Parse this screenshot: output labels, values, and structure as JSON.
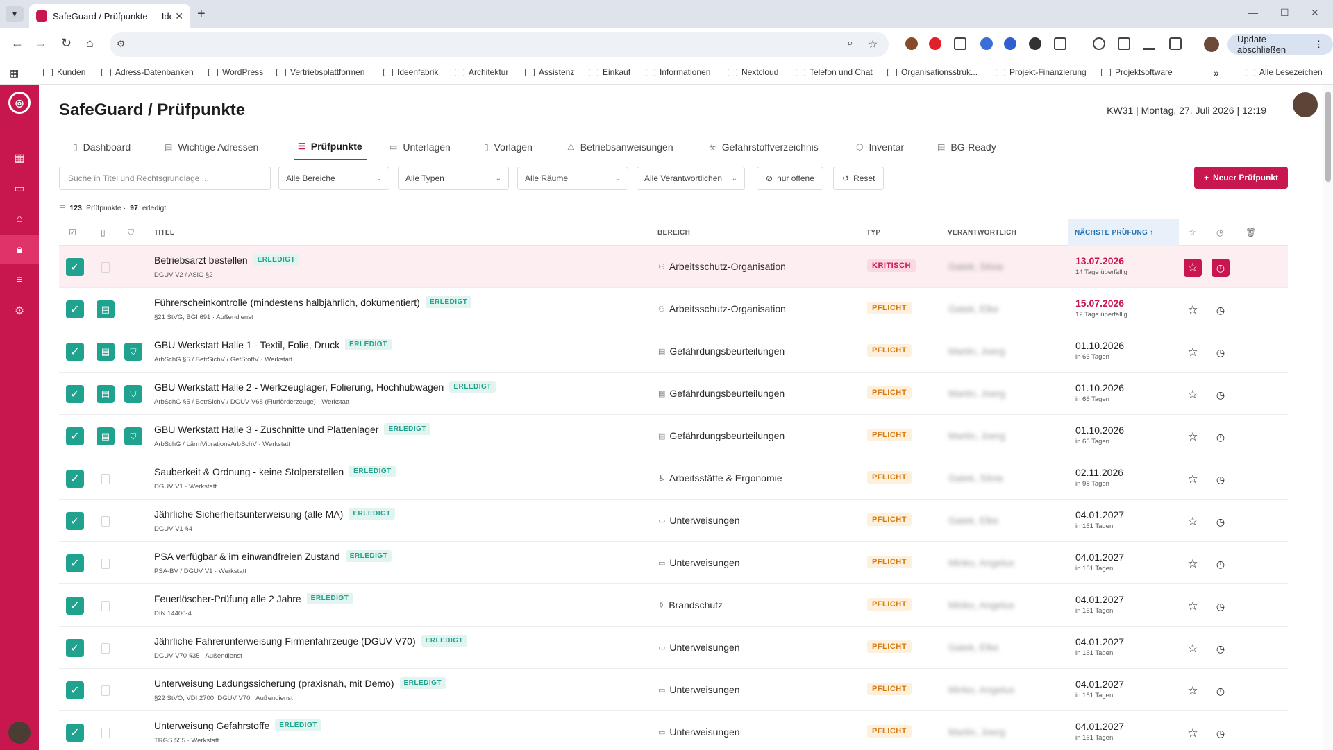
{
  "browser": {
    "tab_title": "SafeGuard / Prüfpunkte — Idee",
    "update_label": "Update abschließen",
    "bookmarks": [
      "Kunden",
      "Adress-Datenbanken",
      "WordPress",
      "Vertriebsplattformen",
      "Ideenfabrik",
      "Architektur",
      "Assistenz",
      "Einkauf",
      "Informationen",
      "Nextcloud",
      "Telefon und Chat",
      "Organisationsstruk...",
      "Projekt-Finanzierung",
      "Projektsoftware"
    ],
    "all_bookmarks": "Alle Lesezeichen"
  },
  "page": {
    "title": "SafeGuard / Prüfpunkte",
    "date_line": "KW31 | Montag, 27. Juli 2026 | 12:19"
  },
  "nav_tabs": [
    {
      "label": "Dashboard",
      "icon": "doc-icon"
    },
    {
      "label": "Wichtige Adressen",
      "icon": "address-icon"
    },
    {
      "label": "Prüfpunkte",
      "icon": "list-icon",
      "active": true
    },
    {
      "label": "Unterlagen",
      "icon": "folder-icon"
    },
    {
      "label": "Vorlagen",
      "icon": "template-icon"
    },
    {
      "label": "Betriebsanweisungen",
      "icon": "warning-icon"
    },
    {
      "label": "Gefahrstoffverzeichnis",
      "icon": "hazard-icon"
    },
    {
      "label": "Inventar",
      "icon": "box-icon"
    },
    {
      "label": "BG-Ready",
      "icon": "clipboard-icon"
    }
  ],
  "filters": {
    "search_placeholder": "Suche in Titel und Rechtsgrundlage ...",
    "areas": "Alle Bereiche",
    "types": "Alle Typen",
    "rooms": "Alle Räume",
    "responsible": "Alle Verantwortlichen",
    "only_open": "nur offene",
    "reset": "Reset",
    "new_button": "Neuer Prüfpunkt"
  },
  "summary": {
    "count": "123",
    "count_label": "Prüfpunkte ·",
    "done": "97",
    "done_label": "erledigt"
  },
  "columns": {
    "title": "TITEL",
    "area": "BEREICH",
    "type": "TYP",
    "responsible": "VERANTWORTLICH",
    "next": "NÄCHSTE PRÜFUNG ↑"
  },
  "colors": {
    "accent": "#c8174f",
    "done": "#1fa28e",
    "pflicht": "#d87a10"
  },
  "rows": [
    {
      "title": "Betriebsarzt bestellen",
      "badge": "ERLEDIGT",
      "sub": "DGUV V2 / ASiG §2",
      "area": "Arbeitsschutz-Organisation",
      "area_icon": "org-icon",
      "type": "KRITISCH",
      "responsible": "Gatek, Silvia",
      "date": "13.07.2026",
      "date_sub": "14 Tage überfällig",
      "overdue": true,
      "critical": true,
      "doc": false,
      "shield": false
    },
    {
      "title": "Führerscheinkontrolle (mindestens halbjährlich, dokumentiert)",
      "badge": "ERLEDIGT",
      "sub": "§21 StVG, BGI 691 · Außendienst",
      "area": "Arbeitsschutz-Organisation",
      "area_icon": "org-icon",
      "type": "PFLICHT",
      "responsible": "Gatek, Elke",
      "date": "15.07.2026",
      "date_sub": "12 Tage überfällig",
      "overdue": true,
      "critical": false,
      "doc": true,
      "shield": false
    },
    {
      "title": "GBU Werkstatt Halle 1 - Textil, Folie, Druck",
      "badge": "ERLEDIGT",
      "sub": "ArbSchG §5 / BetrSichV / GefStoffV · Werkstatt",
      "area": "Gefährdungsbeurteilungen",
      "area_icon": "clipboard-icon",
      "type": "PFLICHT",
      "responsible": "Martin, Joerg",
      "date": "01.10.2026",
      "date_sub": "in 66 Tagen",
      "overdue": false,
      "critical": false,
      "doc": true,
      "shield": true
    },
    {
      "title": "GBU Werkstatt Halle 2 - Werkzeuglager, Folierung, Hochhubwagen",
      "badge": "ERLEDIGT",
      "sub": "ArbSchG §5 / BetrSichV / DGUV V68 (Flurförderzeuge) · Werkstatt",
      "area": "Gefährdungsbeurteilungen",
      "area_icon": "clipboard-icon",
      "type": "PFLICHT",
      "responsible": "Martin, Joerg",
      "date": "01.10.2026",
      "date_sub": "in 66 Tagen",
      "overdue": false,
      "critical": false,
      "doc": true,
      "shield": true
    },
    {
      "title": "GBU Werkstatt Halle 3 - Zuschnitte und Plattenlager",
      "badge": "ERLEDIGT",
      "sub": "ArbSchG / LärmVibrationsArbSchV · Werkstatt",
      "area": "Gefährdungsbeurteilungen",
      "area_icon": "clipboard-icon",
      "type": "PFLICHT",
      "responsible": "Martin, Joerg",
      "date": "01.10.2026",
      "date_sub": "in 66 Tagen",
      "overdue": false,
      "critical": false,
      "doc": true,
      "shield": true
    },
    {
      "title": "Sauberkeit & Ordnung - keine Stolperstellen",
      "badge": "ERLEDIGT",
      "sub": "DGUV V1 · Werkstatt",
      "area": "Arbeitsstätte & Ergonomie",
      "area_icon": "ergo-icon",
      "type": "PFLICHT",
      "responsible": "Gatek, Silvia",
      "date": "02.11.2026",
      "date_sub": "in 98 Tagen",
      "overdue": false,
      "critical": false,
      "doc": false,
      "shield": false
    },
    {
      "title": "Jährliche Sicherheitsunterweisung (alle MA)",
      "badge": "ERLEDIGT",
      "sub": "DGUV V1 §4",
      "area": "Unterweisungen",
      "area_icon": "presentation-icon",
      "type": "PFLICHT",
      "responsible": "Gatek, Elke",
      "date": "04.01.2027",
      "date_sub": "in 161 Tagen",
      "overdue": false,
      "critical": false,
      "doc": false,
      "shield": false
    },
    {
      "title": "PSA verfügbar & im einwandfreien Zustand",
      "badge": "ERLEDIGT",
      "sub": "PSA-BV / DGUV V1 · Werkstatt",
      "area": "Unterweisungen",
      "area_icon": "presentation-icon",
      "type": "PFLICHT",
      "responsible": "Minko, Angelus",
      "date": "04.01.2027",
      "date_sub": "in 161 Tagen",
      "overdue": false,
      "critical": false,
      "doc": false,
      "shield": false
    },
    {
      "title": "Feuerlöscher-Prüfung alle 2 Jahre",
      "badge": "ERLEDIGT",
      "sub": "DIN 14406-4",
      "area": "Brandschutz",
      "area_icon": "extinguisher-icon",
      "type": "PFLICHT",
      "responsible": "Minko, Angelus",
      "date": "04.01.2027",
      "date_sub": "in 161 Tagen",
      "overdue": false,
      "critical": false,
      "doc": false,
      "shield": false
    },
    {
      "title": "Jährliche Fahrerunterweisung Firmenfahrzeuge (DGUV V70)",
      "badge": "ERLEDIGT",
      "sub": "DGUV V70 §35 · Außendienst",
      "area": "Unterweisungen",
      "area_icon": "presentation-icon",
      "type": "PFLICHT",
      "responsible": "Gatek, Elke",
      "date": "04.01.2027",
      "date_sub": "in 161 Tagen",
      "overdue": false,
      "critical": false,
      "doc": false,
      "shield": false
    },
    {
      "title": "Unterweisung Ladungssicherung (praxisnah, mit Demo)",
      "badge": "ERLEDIGT",
      "sub": "§22 StVO, VDI 2700, DGUV V70 · Außendienst",
      "area": "Unterweisungen",
      "area_icon": "presentation-icon",
      "type": "PFLICHT",
      "responsible": "Minko, Angelus",
      "date": "04.01.2027",
      "date_sub": "in 161 Tagen",
      "overdue": false,
      "critical": false,
      "doc": false,
      "shield": false
    },
    {
      "title": "Unterweisung Gefahrstoffe",
      "badge": "ERLEDIGT",
      "sub": "TRGS 555 · Werkstatt",
      "area": "Unterweisungen",
      "area_icon": "presentation-icon",
      "type": "PFLICHT",
      "responsible": "Martin, Joerg",
      "date": "04.01.2027",
      "date_sub": "in 161 Tagen",
      "overdue": false,
      "critical": false,
      "doc": false,
      "shield": false
    }
  ]
}
